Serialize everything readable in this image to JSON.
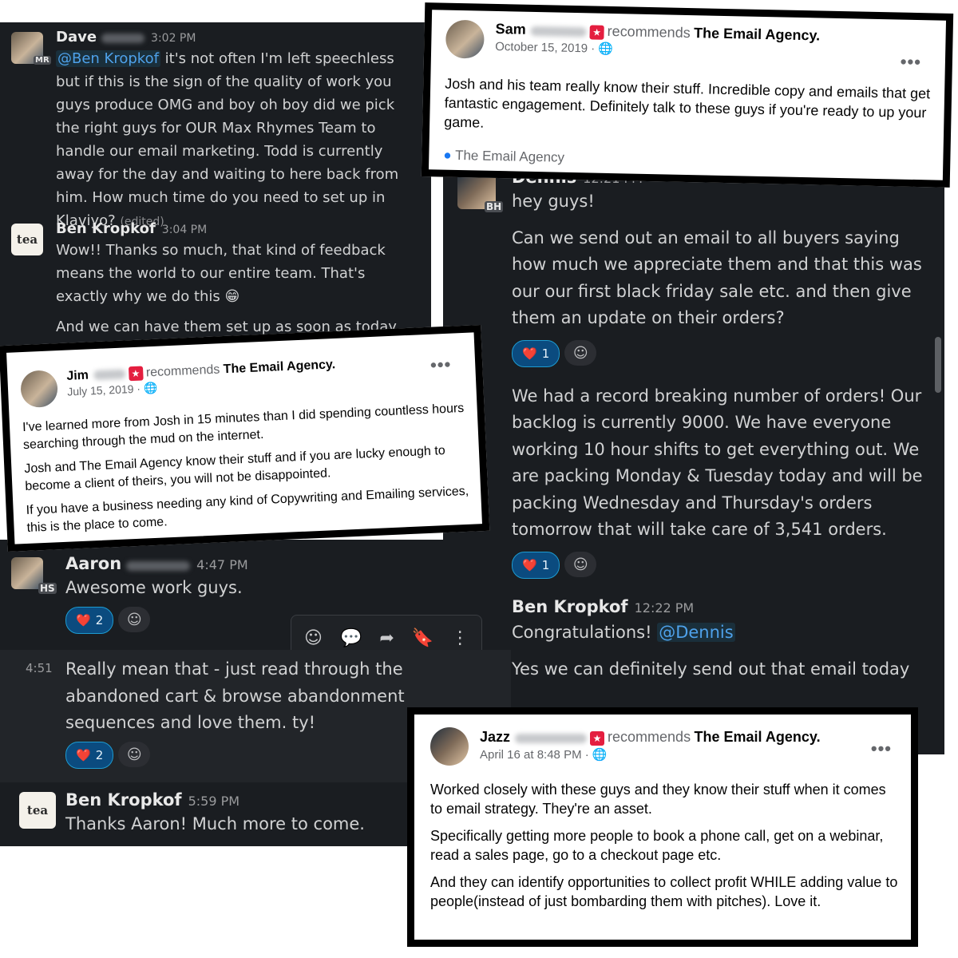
{
  "slack_left": {
    "msg1": {
      "author": "Dave",
      "time": "3:02 PM",
      "tag": "MR",
      "mention": "@Ben Kropkof",
      "text": " it's not often I'm left speechless but if this is the sign of the quality of work you guys produce OMG and boy oh boy did we pick the right guys for OUR Max Rhymes Team to handle our email marketing. Todd is currently away for the day and waiting to here back from him. How much time do you need to set up in Klaviyo?",
      "edited": "(edited)"
    },
    "msg2": {
      "author": "Ben Kropkof",
      "time": "3:04 PM",
      "avatar": "tea",
      "text": "Wow!! Thanks so much, that kind of feedback means the world to our entire team. That's exactly why we do this",
      "emoji": "😁",
      "text2": "And we can have them set up as soon as today"
    }
  },
  "fb_sam": {
    "name": "Sam",
    "recommends": "recommends",
    "page": "The Email Agency.",
    "date": "October 15, 2019 ·",
    "text": "Josh and his team really know their stuff. Incredible copy and emails that get fantastic engagement. Definitely talk to these guys if you're ready to up your game.",
    "footer": "The Email Agency"
  },
  "fb_jim": {
    "name": "Jim",
    "recommends": "recommends",
    "page": "The Email Agency.",
    "date": "July 15, 2019 ·",
    "p1": "I've learned more from Josh in 15 minutes than I did spending countless hours searching through the mud on the internet.",
    "p2": "Josh and The Email Agency know their stuff and if you are lucky enough to become a client of theirs, you will not be disappointed.",
    "p3": "If you have a business needing any kind of Copywriting and Emailing services, this is the place to come."
  },
  "slack_bottom": {
    "msg1": {
      "author": "Aaron",
      "time": "4:47 PM",
      "tag": "HS",
      "text": "Awesome work guys.",
      "reaction": "2"
    },
    "msg2": {
      "time": "4:51",
      "text": "Really mean that - just read through the abandoned cart & browse abandonment sequences and love them.  ty!",
      "reaction": "2"
    },
    "msg3": {
      "author": "Ben Kropkof",
      "time": "5:59 PM",
      "avatar": "tea",
      "text": "Thanks Aaron! Much more to come."
    }
  },
  "slack_right": {
    "msg1": {
      "author": "Dennis",
      "time": "12:21 PM",
      "tag": "BH",
      "text": "hey guys!",
      "p2": "Can we send out an email to all buyers saying how much we appreciate them and that this was our our first black friday sale etc. and then give them an update on their orders?",
      "reaction": "1",
      "p3": "We had a record breaking number of orders! Our backlog is currently 9000. We have everyone working 10 hour shifts to get everything out. We are packing Monday & Tuesday today and will be packing Wednesday and Thursday's orders tomorrow that will take care of 3,541 orders.",
      "reaction2": "1"
    },
    "msg2": {
      "author": "Ben Kropkof",
      "time": "12:22 PM",
      "text": "Congratulations!",
      "mention": "@Dennis",
      "text2": "Yes we can definitely send out that email today"
    }
  },
  "fb_jazz": {
    "name": "Jazz",
    "recommends": "recommends",
    "page": "The Email Agency.",
    "date": "April 16 at 8:48 PM ·",
    "p1": "Worked closely with these guys and they know their stuff when it comes to email strategy. They're an asset.",
    "p2": "Specifically getting more people to book a phone call, get on a webinar, read a sales page, go to a checkout page etc.",
    "p3": "And they can identify opportunities to collect profit WHILE adding value to people(instead of just  bombarding them with pitches). Love it."
  },
  "icons": {
    "heart": "heart-icon",
    "emoji_add": "add-reaction-icon",
    "globe": "globe-icon",
    "more": "more-icon"
  },
  "colors": {
    "slack_bg": "#1a1d21",
    "mention": "#4ea1ea",
    "reaction_bg": "#0b4b7f",
    "fb_star": "#e41e3f"
  }
}
